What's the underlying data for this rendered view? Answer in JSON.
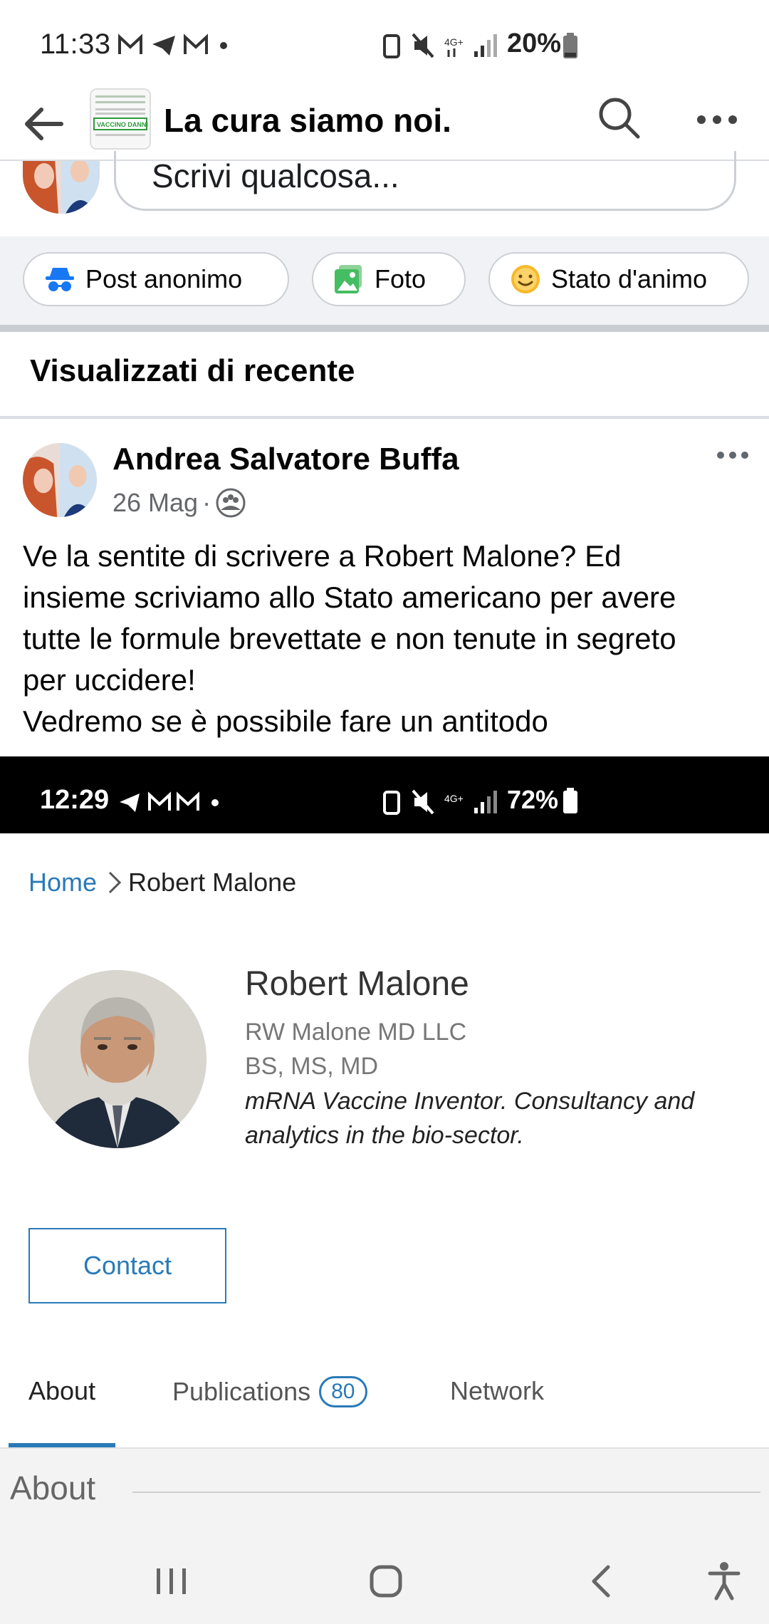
{
  "status_bar": {
    "time": "11:33",
    "battery": "20%",
    "network": "4G+"
  },
  "header": {
    "title": "La cura siamo noi."
  },
  "composer": {
    "placeholder": "Scrivi qualcosa...",
    "chips": [
      {
        "label": "Post anonimo",
        "icon": "incognito-icon"
      },
      {
        "label": "Foto",
        "icon": "photo-icon"
      },
      {
        "label": "Stato d'animo",
        "icon": "smiley-icon"
      }
    ]
  },
  "recent_section": {
    "title": "Visualizzati di recente"
  },
  "post": {
    "author": "Andrea Salvatore Buffa",
    "date": "26 Mag",
    "text_lines": [
      "Ve la sentite di scrivere a Robert Malone? Ed",
      "insieme scriviamo allo Stato americano per avere",
      "tutte le formule brevettate e non tenute in segreto",
      "per uccidere!",
      "Vedremo se è possibile fare un antitodo"
    ]
  },
  "embedded_screenshot": {
    "status_bar": {
      "time": "12:29",
      "battery": "72%"
    },
    "breadcrumb": {
      "home": "Home",
      "current": "Robert Malone"
    },
    "profile": {
      "name": "Robert Malone",
      "company": "RW Malone MD LLC",
      "degrees": "BS, MS, MD",
      "bio_line1": "mRNA Vaccine Inventor. Consultancy and",
      "bio_line2": "analytics in the bio-sector."
    },
    "contact_label": "Contact",
    "tabs": [
      {
        "label": "About",
        "active": true
      },
      {
        "label": "Publications",
        "badge": "80"
      },
      {
        "label": "Network"
      }
    ],
    "about_heading": "About"
  },
  "colors": {
    "facebook_text": "#050505",
    "secondary_text": "#65676b",
    "link_blue": "#2a7ab8",
    "photo_green": "#45bd62",
    "smiley_yellow": "#f7b928",
    "incognito_blue": "#1877f2"
  }
}
